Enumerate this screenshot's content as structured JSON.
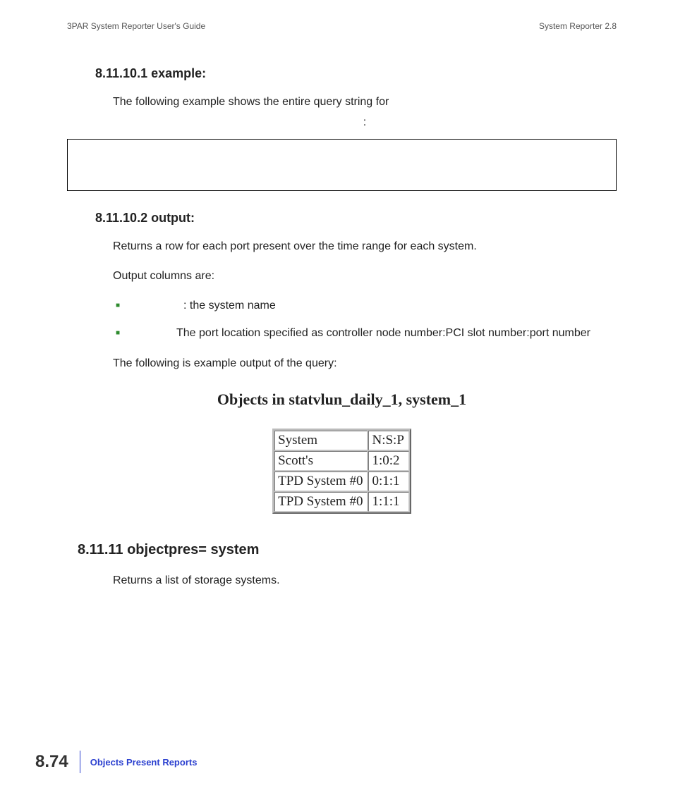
{
  "header": {
    "left": "3PAR System Reporter User's Guide",
    "right": "System Reporter 2.8"
  },
  "sections": {
    "example": {
      "heading": "8.11.10.1 example:",
      "intro": "The following example shows the entire query string for",
      "colon": ":"
    },
    "output": {
      "heading": "8.11.10.2 output:",
      "line1": "Returns a row for each port present over the time range for each system.",
      "line2": "Output columns are:",
      "bullets": [
        {
          "after": ": the system name"
        },
        {
          "after": "The port location specified as controller node number:PCI slot number:port number"
        }
      ],
      "line3": "The following is example output of the query:"
    },
    "figure": {
      "title": "Objects in statvlun_daily_1, system_1",
      "rows": [
        [
          "System",
          "N:S:P"
        ],
        [
          "Scott's",
          "1:0:2"
        ],
        [
          "TPD System #0",
          "0:1:1"
        ],
        [
          "TPD System #0",
          "1:1:1"
        ]
      ]
    },
    "nextSection": {
      "heading": "8.11.11 objectpres= system",
      "line1": "Returns a list of storage systems."
    }
  },
  "footer": {
    "pageNum": "8.74",
    "title": "Objects Present Reports"
  }
}
